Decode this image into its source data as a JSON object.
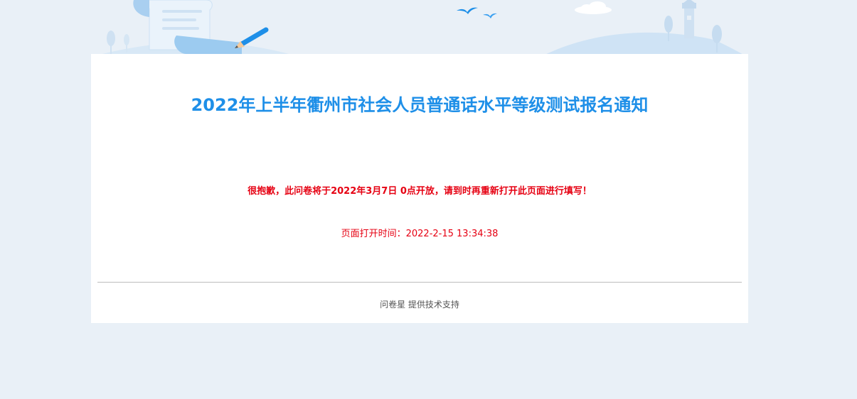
{
  "survey": {
    "title": "2022年上半年衢州市社会人员普通话水平等级测试报名通知",
    "notice": "很抱歉，此问卷将于2022年3月7日 0点开放，请到时再重新打开此页面进行填写！",
    "open_time_label": "页面打开时间：",
    "open_time_value": "2022-2-15 13:34:38"
  },
  "footer": {
    "brand": "问卷星",
    "support_text": " 提供技术支持"
  },
  "colors": {
    "title": "#1e8fe8",
    "notice": "#e60012",
    "background": "#e9f0f7"
  },
  "icons": [
    "scroll-icon",
    "pencil-icon",
    "bird-icon",
    "cloud-icon",
    "lighthouse-icon",
    "tree-icon"
  ]
}
